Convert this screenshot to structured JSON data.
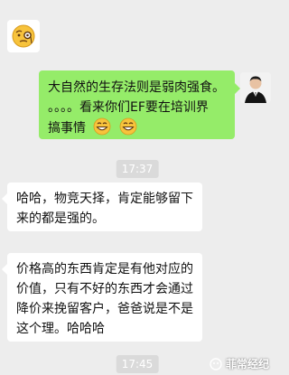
{
  "messages": [
    {
      "type": "sticker",
      "icon": "monocle-face-emoji"
    },
    {
      "type": "outgoing",
      "line1": "大自然的生存法则是弱肉强食。",
      "line2": "。。。。看来你们EF要在培训界",
      "line3": "搞事情"
    },
    {
      "type": "time",
      "text": "17:37"
    },
    {
      "type": "incoming",
      "line1": "哈哈，物竞天择，肯定能够留下",
      "line2": "来的都是强的。"
    },
    {
      "type": "incoming",
      "line1": "价格高的东西肯定是有他对应的",
      "line2": "价值，只有不好的东西才会通过",
      "line3": "降价来挽留客户，爸爸说是不是",
      "line4": "这个理。哈哈哈"
    },
    {
      "type": "time",
      "text": "17:45"
    }
  ],
  "watermark": {
    "text": "菲常经纪"
  },
  "colors": {
    "background": "#ededed",
    "outgoing_bubble": "#95ec69",
    "incoming_bubble": "#ffffff",
    "time_pill": "#dadada"
  }
}
